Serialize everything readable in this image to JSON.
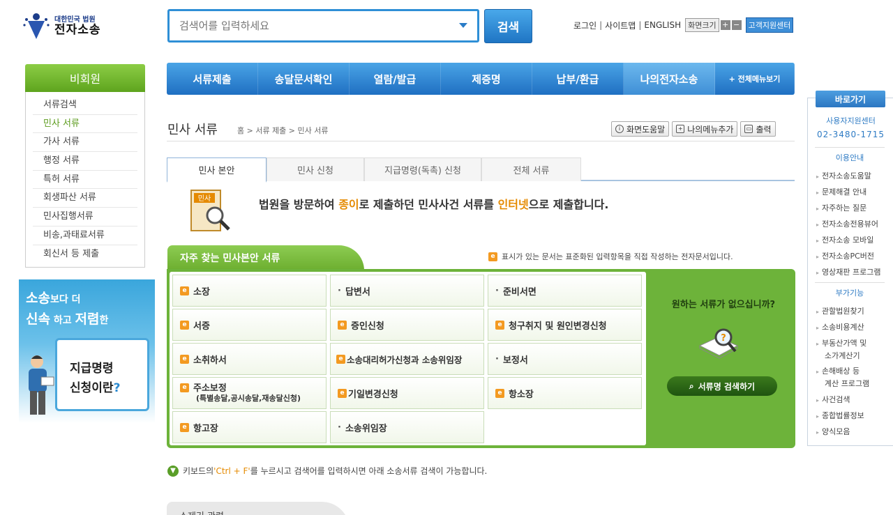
{
  "logo": {
    "line1": "대한민국 법원",
    "line2": "전자소송"
  },
  "search": {
    "placeholder": "검색어를 입력하세요",
    "button": "검색"
  },
  "util": {
    "login": "로그인",
    "sitemap": "사이트맵",
    "english": "ENGLISH",
    "font_size": "화면크기",
    "plus": "+",
    "minus": "−",
    "support": "고객지원센터"
  },
  "sidebar": {
    "title": "비회원",
    "items": [
      "서류검색",
      "민사 서류",
      "가사 서류",
      "행정 서류",
      "특허 서류",
      "회생파산 서류",
      "민사집행서류",
      "비송,과태료서류",
      "회신서 등 제출"
    ]
  },
  "banner": {
    "w1": "소송",
    "w1b": "보다 더",
    "w2": "신속",
    "w2b": "하고",
    "w3": "저렴",
    "w3b": "한",
    "c1": "지급명령",
    "c2a": "신청이란",
    "c2b": "?"
  },
  "nav": {
    "items": [
      "서류제출",
      "송달문서확인",
      "열람/발급",
      "제증명",
      "납부/환급",
      "나의전자소송"
    ],
    "all": "+ 전체메뉴보기"
  },
  "page": {
    "title": "민사 서류",
    "breadcrumb": "홈 > 서류 제출 > 민사 서류",
    "tools": [
      "화면도움말",
      "나의메뉴추가",
      "출력"
    ]
  },
  "tabs": [
    "민사 본안",
    "민사 신청",
    "지급명령(독촉) 신청",
    "전체 서류"
  ],
  "intro": {
    "icon_label": "민사",
    "a": "법원을 방문하여 ",
    "b": "종이",
    "c": "로 제출하던 민사사건 서류를 ",
    "d": "인터넷",
    "e": "으로 제출합니다."
  },
  "panel": {
    "title": "자주 찾는 민사본안 서류",
    "note": "표시가 있는 문서는 표준화된 입력항목을 직접 작성하는 전자문서입니다.",
    "cells": [
      {
        "label": "소장",
        "e": true
      },
      {
        "label": "답변서",
        "e": false
      },
      {
        "label": "준비서면",
        "e": false
      },
      {
        "label": "서증",
        "e": true
      },
      {
        "label": "증인신청",
        "e": true
      },
      {
        "label": "청구취지 및 원인변경신청",
        "e": true
      },
      {
        "label": "소취하서",
        "e": true
      },
      {
        "label": "소송대리허가신청과 소송위임장",
        "e": true
      },
      {
        "label": "보정서",
        "e": false
      },
      {
        "label": "주소보정",
        "sub": "(특별송달,공시송달,재송달신청)",
        "e": true
      },
      {
        "label": "기일변경신청",
        "e": true
      },
      {
        "label": "항소장",
        "e": true
      },
      {
        "label": "항고장",
        "e": true
      },
      {
        "label": "소송위임장",
        "e": false
      }
    ],
    "right_q": "원하는 서류가 없으십니까?",
    "right_btn": "서류명 검색하기"
  },
  "bottom": {
    "a": "키보드의 ",
    "b": "'Ctrl + F'",
    "c": "를 누르시고 검색어를 입력하시면 아래 소송서류 검색이 가능합니다.",
    "next_tab": "소제기 관련"
  },
  "quick": {
    "title": "바로가기",
    "center": "사용자지원센터",
    "phone": "02-3480-1715",
    "sect1": "이용안내",
    "list1": [
      "전자소송도움말",
      "문제해결 안내",
      "자주하는 질문",
      "전자소송전용뷰어",
      "전자소송 모바일",
      "전자소송PC버전",
      "영상재판 프로그램"
    ],
    "sect2": "부가기능",
    "list2": [
      "관할법원찾기",
      "소송비용계산",
      "부동산가액 및",
      "소가계산기",
      "손해배상 등",
      "계산 프로그램",
      "사건검색",
      "종합법률정보",
      "양식모음"
    ]
  },
  "colors": {
    "brand_blue": "#2f8fd6",
    "brand_green": "#6db33a",
    "accent_orange": "#e58a00"
  }
}
